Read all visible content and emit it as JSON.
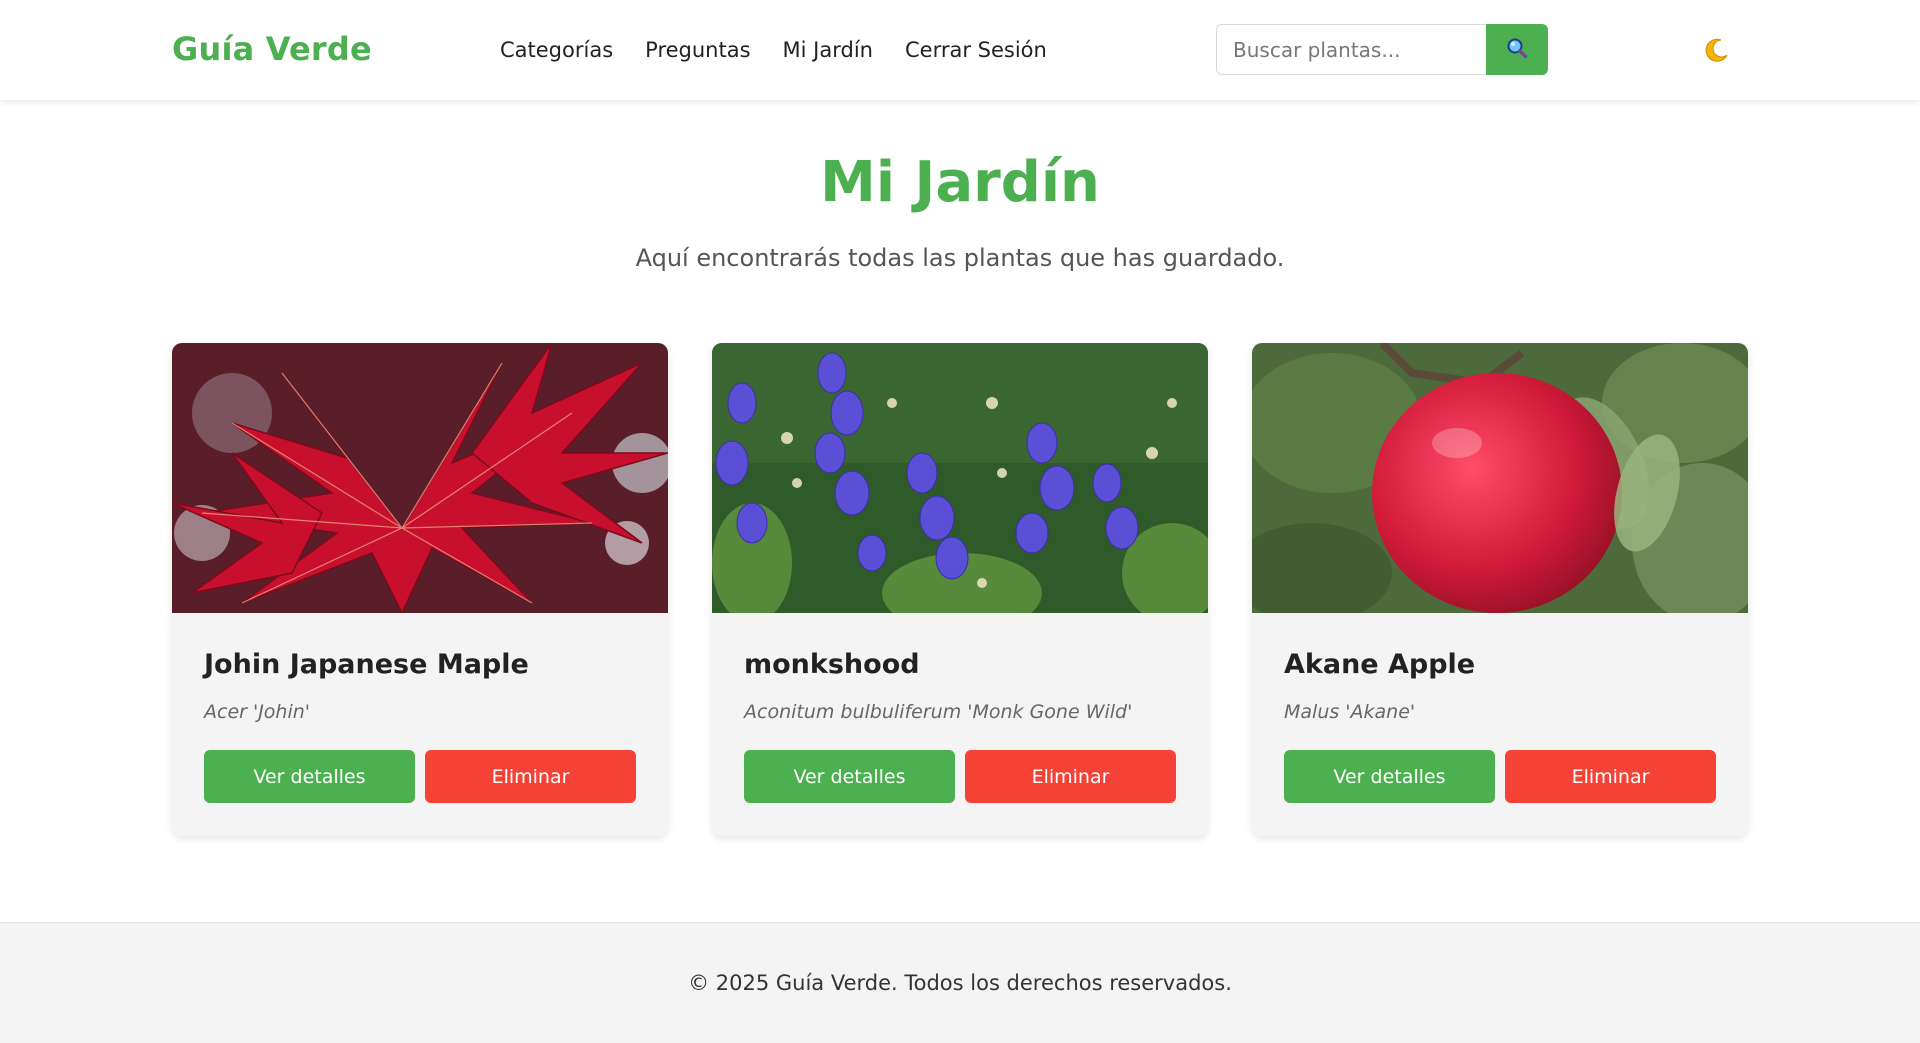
{
  "header": {
    "logo": "Guía Verde",
    "nav": [
      "Categorías",
      "Preguntas",
      "Mi Jardín",
      "Cerrar Sesión"
    ],
    "search": {
      "placeholder": "Buscar plantas...",
      "value": "",
      "icon": "search-icon"
    },
    "theme_toggle_icon": "moon-icon"
  },
  "main": {
    "title": "Mi Jardín",
    "subtitle": "Aquí encontrarás todas las plantas que has guardado.",
    "plants": [
      {
        "name": "Johin Japanese Maple",
        "scientific": "Acer 'Johin'",
        "details_label": "Ver detalles",
        "delete_label": "Eliminar",
        "image": "red-maple-leaves"
      },
      {
        "name": "monkshood",
        "scientific": "Aconitum bulbuliferum 'Monk Gone Wild'",
        "details_label": "Ver detalles",
        "delete_label": "Eliminar",
        "image": "purple-monkshood-flowers"
      },
      {
        "name": "Akane Apple",
        "scientific": "Malus 'Akane'",
        "details_label": "Ver detalles",
        "delete_label": "Eliminar",
        "image": "red-apple-on-branch"
      }
    ]
  },
  "footer": {
    "text": "© 2025 Guía Verde. Todos los derechos reservados."
  },
  "colors": {
    "brand": "#4caf50",
    "danger": "#f44336",
    "card_bg": "#f4f4f4"
  }
}
